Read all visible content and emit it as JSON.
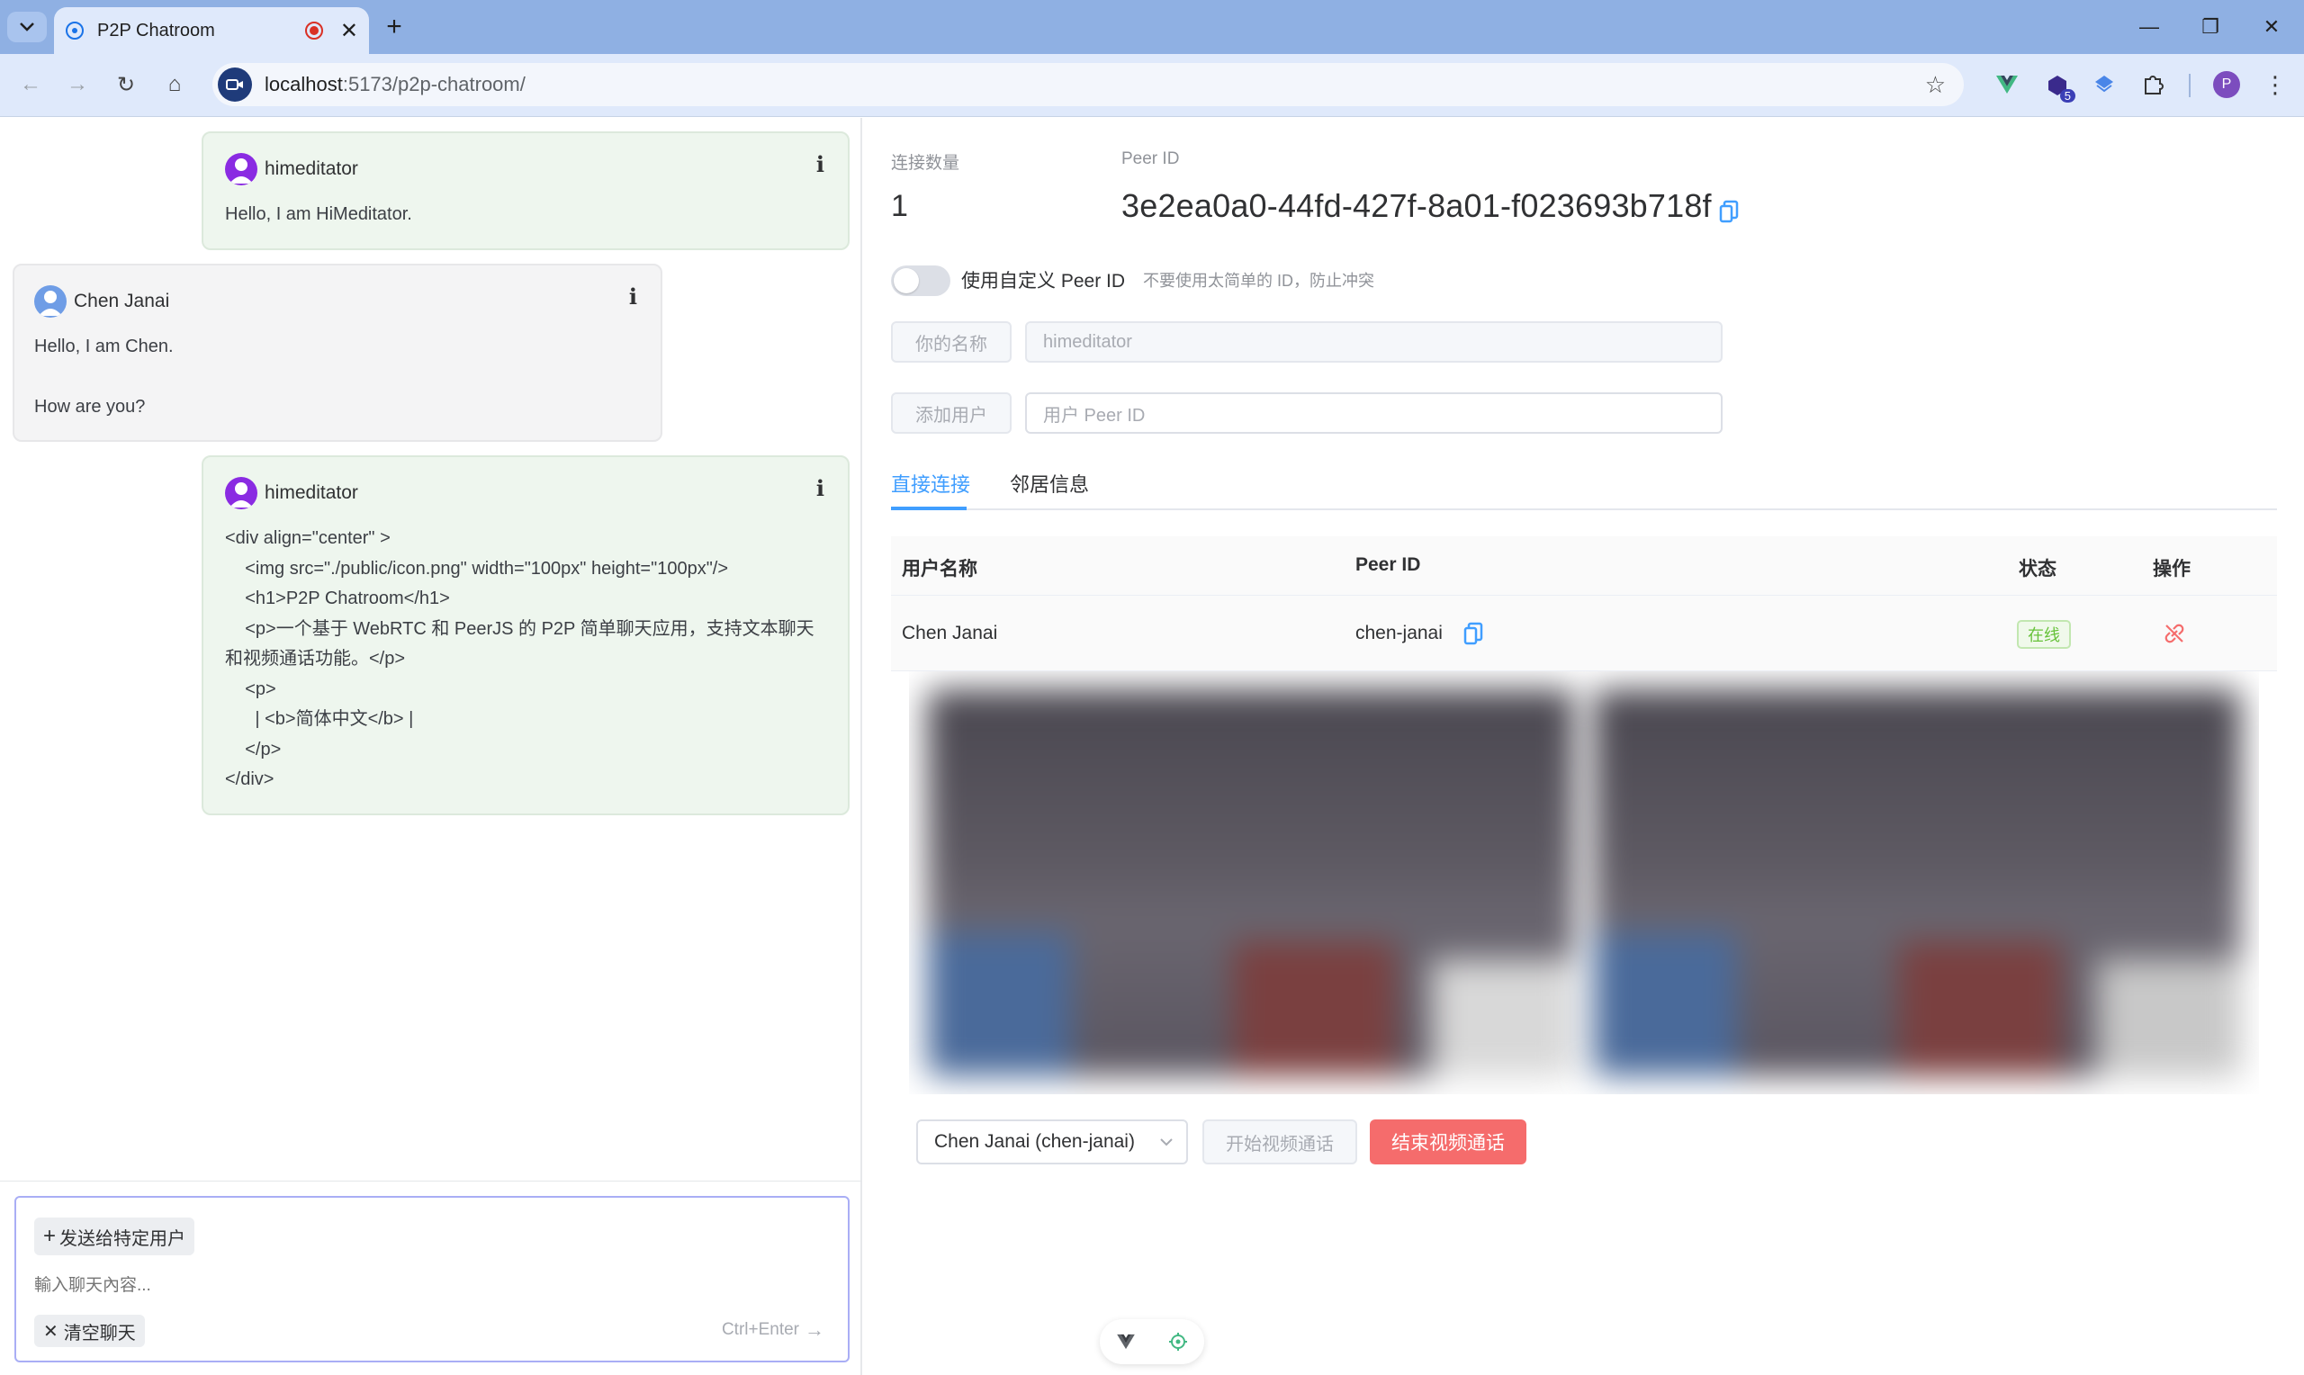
{
  "browser": {
    "tab_title": "P2P Chatroom",
    "url_host": "localhost",
    "url_path": ":5173/p2p-chatroom/",
    "extension_badge": "5",
    "profile_initial": "P"
  },
  "chat": {
    "messages": [
      {
        "user": "himeditator",
        "text": "Hello, I am HiMeditator."
      },
      {
        "user": "Chen Janai",
        "text": "Hello, I am Chen.\n\nHow are you?"
      },
      {
        "user": "himeditator",
        "text": "<div align=\"center\" >\n    <img src=\"./public/icon.png\" width=\"100px\" height=\"100px\"/>\n    <h1>P2P Chatroom</h1>\n    <p>一个基于 WebRTC 和 PeerJS 的 P2P 简单聊天应用，支持文本聊天\n和视频通话功能。</p>\n    <p>\n      | <b>简体中文</b> |\n    </p>\n</div>"
      }
    ],
    "info_icon": "i",
    "composer": {
      "send_to_label": "发送给特定用户",
      "placeholder": "輸入聊天內容...",
      "clear_label": "清空聊天",
      "send_hint": "Ctrl+Enter"
    }
  },
  "panel": {
    "connection_count_label": "连接数量",
    "connection_count": "1",
    "peer_id_label": "Peer ID",
    "peer_id": "3e2ea0a0-44fd-427f-8a01-f023693b718f",
    "custom_toggle_label": "使用自定义 Peer ID",
    "custom_toggle_on": false,
    "custom_hint": "不要使用太简单的 ID，防止冲突",
    "name_button": "你的名称",
    "name_placeholder": "himeditator",
    "add_user_button": "添加用户",
    "peer_input_placeholder": "用户 Peer ID",
    "tabs": [
      "直接连接",
      "邻居信息"
    ],
    "active_tab": 0,
    "table": {
      "headers": [
        "用户名称",
        "Peer ID",
        "状态",
        "操作"
      ],
      "rows": [
        {
          "name": "Chen Janai",
          "peer_id": "chen-janai",
          "status": "在线"
        }
      ]
    },
    "video_select": "Chen Janai (chen-janai)",
    "start_call": "开始视频通话",
    "end_call": "结束视频通话"
  },
  "colors": {
    "primary": "#409eff",
    "danger": "#f56c6c",
    "success": "#67c23a",
    "my_bubble": "#eef6ee",
    "other_bubble": "#f4f4f5"
  }
}
